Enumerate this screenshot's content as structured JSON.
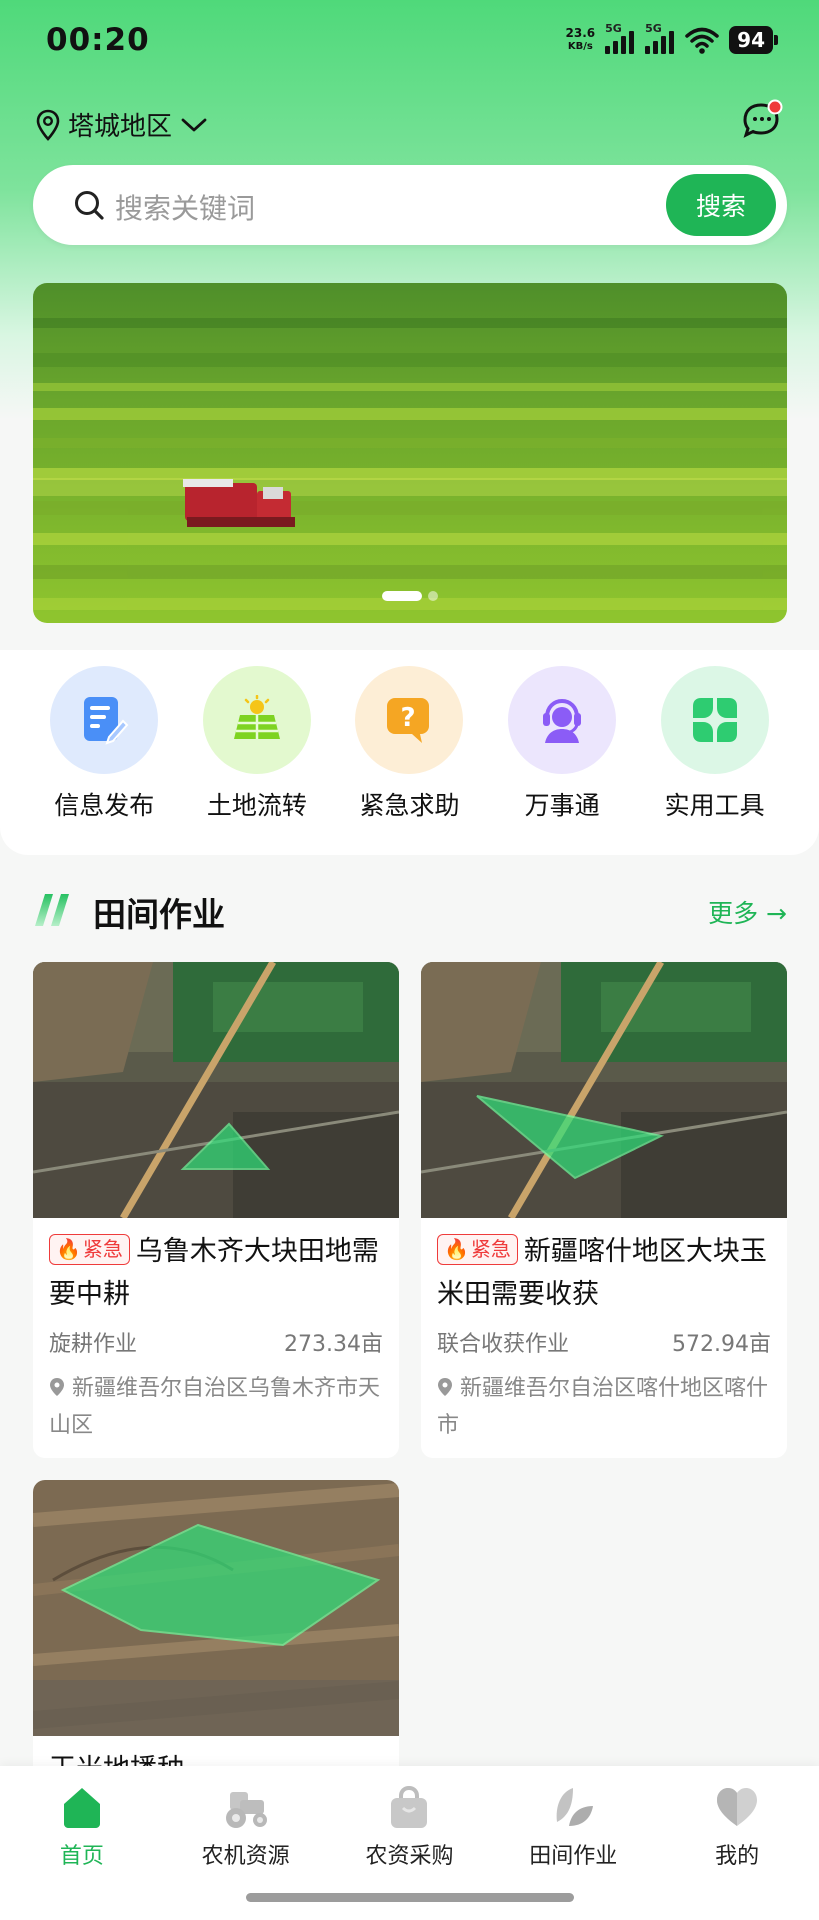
{
  "status_bar": {
    "time": "00:20",
    "net_speed_value": "23.6",
    "net_speed_unit": "KB/s",
    "sim1_label": "5G",
    "sim2_label": "5G",
    "battery": "94"
  },
  "header": {
    "location": "塔城地区",
    "search_placeholder": "搜索关键词",
    "search_button": "搜索"
  },
  "banner": {
    "slide_count": 2,
    "active_slide": 1
  },
  "quick_menu": [
    {
      "label": "信息发布",
      "icon": "edit-document-icon",
      "bg": "#dfeafd",
      "color": "#3b82f6"
    },
    {
      "label": "土地流转",
      "icon": "solar-farm-icon",
      "bg": "#e3f9cf",
      "color": "#7ed321"
    },
    {
      "label": "紧急求助",
      "icon": "help-question-icon",
      "bg": "#fdeed6",
      "color": "#f5a623"
    },
    {
      "label": "万事通",
      "icon": "customer-service-icon",
      "bg": "#ece6fd",
      "color": "#8b5cf6"
    },
    {
      "label": "实用工具",
      "icon": "clover-tools-icon",
      "bg": "#dcf7e6",
      "color": "#2ecc71"
    }
  ],
  "section": {
    "title": "田间作业",
    "more": "更多"
  },
  "cards": [
    {
      "tag": "紧急",
      "title": "乌鲁木齐大块田地需要中耕",
      "type": "旋耕作业",
      "area": "273.34亩",
      "address": "新疆维吾尔自治区乌鲁木齐市天山区"
    },
    {
      "tag": "紧急",
      "title": "新疆喀什地区大块玉米田需要收获",
      "type": "联合收获作业",
      "area": "572.94亩",
      "address": "新疆维吾尔自治区喀什地区喀什市"
    },
    {
      "title": "玉米地播种"
    }
  ],
  "tabbar": [
    {
      "label": "首页",
      "icon": "home-icon",
      "active": true
    },
    {
      "label": "农机资源",
      "icon": "tractor-icon",
      "active": false
    },
    {
      "label": "农资采购",
      "icon": "shopping-bag-icon",
      "active": false
    },
    {
      "label": "田间作业",
      "icon": "leaf-icon",
      "active": false
    },
    {
      "label": "我的",
      "icon": "heart-profile-icon",
      "active": false
    }
  ],
  "colors": {
    "accent": "#1fb556",
    "urgent": "#ef3b3b"
  }
}
